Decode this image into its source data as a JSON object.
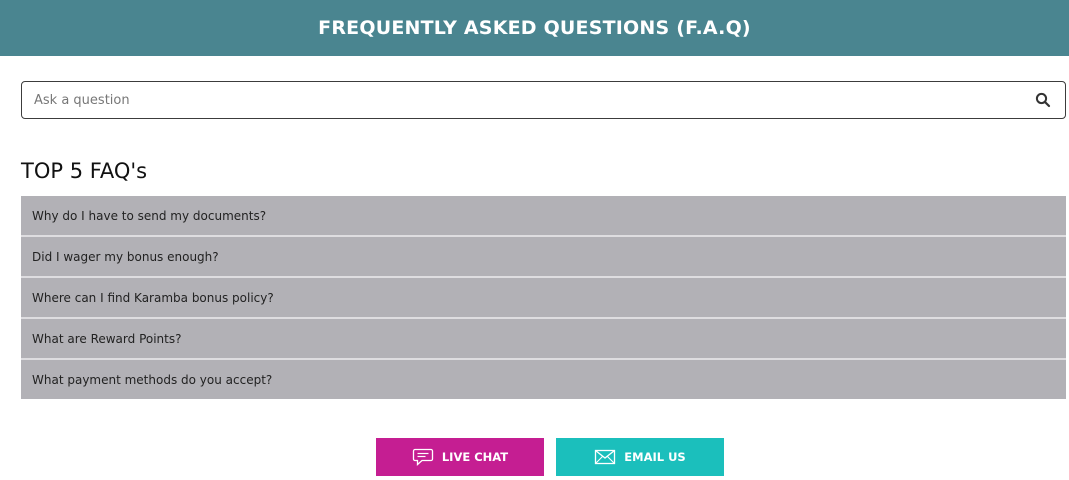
{
  "header": {
    "title": "FREQUENTLY ASKED QUESTIONS (F.A.Q)"
  },
  "search": {
    "placeholder": "Ask a question",
    "value": "",
    "icon": "search-icon"
  },
  "faq_section": {
    "title": "TOP 5 FAQ's",
    "items": [
      {
        "label": "Why do I have to send my documents?"
      },
      {
        "label": "Did I wager my bonus enough?"
      },
      {
        "label": "Where can I find Karamba bonus policy?"
      },
      {
        "label": "What are Reward Points?"
      },
      {
        "label": "What payment methods do you accept?"
      }
    ]
  },
  "actions": {
    "live_chat": {
      "label": "LIVE CHAT",
      "icon": "chat-bubble-icon",
      "color": "#c51e92"
    },
    "email_us": {
      "label": "EMAIL US",
      "icon": "envelope-icon",
      "color": "#1bbfbc"
    }
  },
  "colors": {
    "header_bg": "#4a8590",
    "faq_item_bg": "#b2b1b6"
  }
}
